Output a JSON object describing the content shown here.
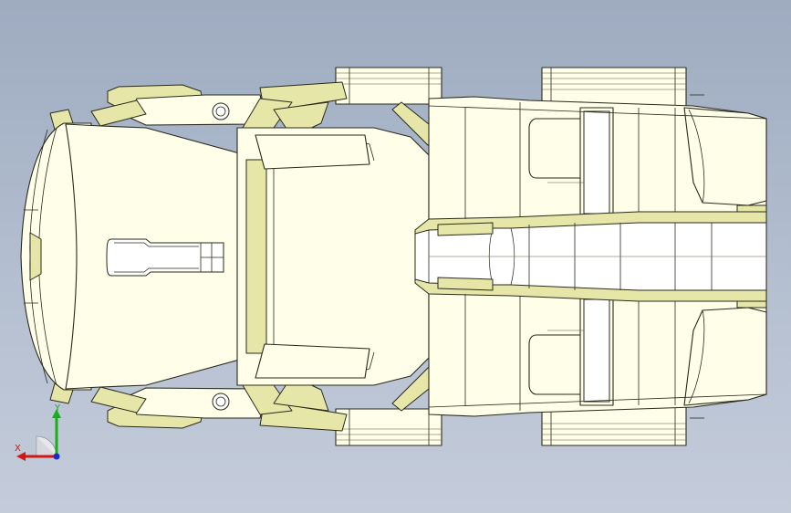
{
  "viewport": {
    "background_top": "#9eabc0",
    "background_bottom": "#c4ccda"
  },
  "model": {
    "view": "top",
    "body_color": "#fefee9",
    "shade_color": "#e6e6a8",
    "edge_color": "#2a2a1c"
  },
  "triad": {
    "x_label": "X",
    "y_label": "Y",
    "x_color": "#d01818",
    "y_color": "#16b016",
    "z_color": "#1a2ad0"
  }
}
